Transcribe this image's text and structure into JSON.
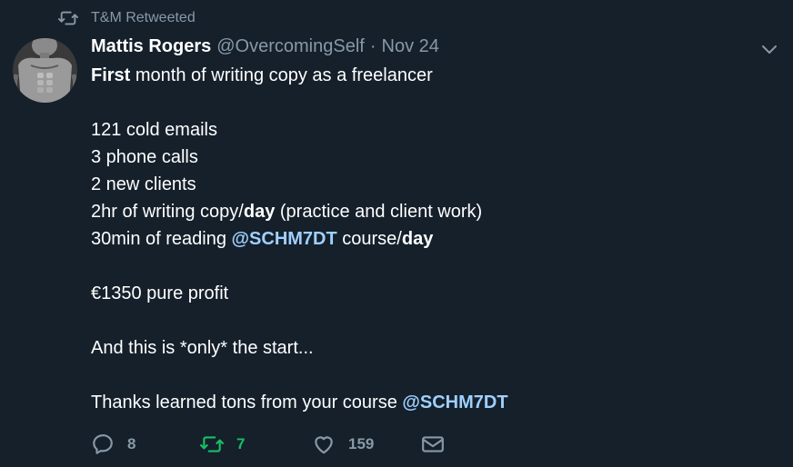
{
  "retweet_context": {
    "text": "T&M Retweeted",
    "icon": "retweet-icon"
  },
  "author": {
    "display_name": "Mattis Rogers",
    "handle": "@OvercomingSelf",
    "separator": "·",
    "timestamp": "Nov 24"
  },
  "tweet": {
    "l1_bold": "First",
    "l1_rest": " month of writing copy as a freelancer",
    "l2": "121 cold emails",
    "l3": "3 phone calls",
    "l4": "2 new clients",
    "l5_a": "2hr of writing copy/",
    "l5_bold": "day",
    "l5_b": " (practice and client work)",
    "l6_a": "30min of reading ",
    "l6_mention": "@SCHM7DT",
    "l6_b": " course/",
    "l6_bold": "day",
    "l7": "€1350 pure profit",
    "l8": "And this is *only* the start...",
    "l9_a": "Thanks learned tons from your course ",
    "l9_mention": "@SCHM7DT"
  },
  "actions": {
    "reply_count": "8",
    "retweet_count": "7",
    "like_count": "159"
  },
  "colors": {
    "background": "#15202b",
    "secondary_text": "#8899a6",
    "mention": "#9fd0ff",
    "retweet_active": "#17bf63"
  }
}
